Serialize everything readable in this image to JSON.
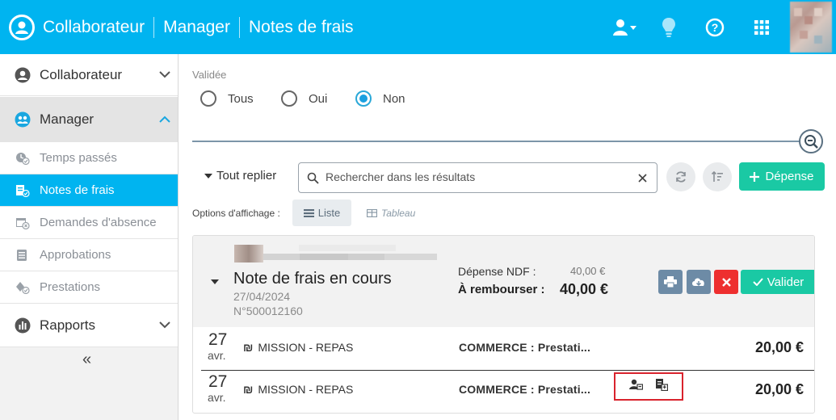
{
  "header": {
    "breadcrumbs": [
      "Collaborateur",
      "Manager",
      "Notes de frais"
    ],
    "icons": [
      "user-menu-icon",
      "lightbulb-icon",
      "help-icon",
      "apps-grid-icon"
    ]
  },
  "sidebar": {
    "main_items": [
      {
        "label": "Collaborateur",
        "icon": "user-circle-icon",
        "expanded": false
      },
      {
        "label": "Manager",
        "icon": "team-icon",
        "expanded": true
      },
      {
        "label": "Rapports",
        "icon": "chart-icon",
        "expanded": false
      }
    ],
    "sub_items": [
      {
        "label": "Temps passés",
        "icon": "clock-check-icon",
        "active": false
      },
      {
        "label": "Notes de frais",
        "icon": "receipt-check-icon",
        "active": true
      },
      {
        "label": "Demandes d'absence",
        "icon": "calendar-x-icon",
        "active": false
      },
      {
        "label": "Approbations",
        "icon": "list-icon",
        "active": false
      },
      {
        "label": "Prestations",
        "icon": "diamond-check-icon",
        "active": false
      }
    ],
    "collapse_symbol": "«"
  },
  "filters": {
    "label": "Validée",
    "options": [
      "Tous",
      "Oui",
      "Non"
    ],
    "selected": "Non"
  },
  "toolbar": {
    "collapse_all": "Tout replier",
    "search_placeholder": "Rechercher dans les résultats",
    "add_label": "Dépense"
  },
  "display_options": {
    "label": "Options d'affichage :",
    "liste": "Liste",
    "tableau": "Tableau",
    "selected": "Liste"
  },
  "note": {
    "title": "Note de frais en cours",
    "date": "27/04/2024",
    "number": "N°500012160",
    "depense_label": "Dépense NDF :",
    "depense_value": "40,00 €",
    "rembourser_label": "À rembourser :",
    "rembourser_value": "40,00 €",
    "validate_label": "Valider"
  },
  "lines": [
    {
      "day": "27",
      "month": "avr.",
      "nature": "MISSION - REPAS",
      "description": "COMMERCE : Prestati...",
      "amount": "20,00 €"
    },
    {
      "day": "27",
      "month": "avr.",
      "nature": "MISSION - REPAS",
      "description": "COMMERCE : Prestati...",
      "amount": "20,00 €"
    }
  ],
  "colors": {
    "primary": "#00b4f0",
    "success": "#1ac9a4",
    "danger": "#ee2f2f",
    "slate_button": "#6d8ba6",
    "highlight_border": "#d9232d"
  }
}
